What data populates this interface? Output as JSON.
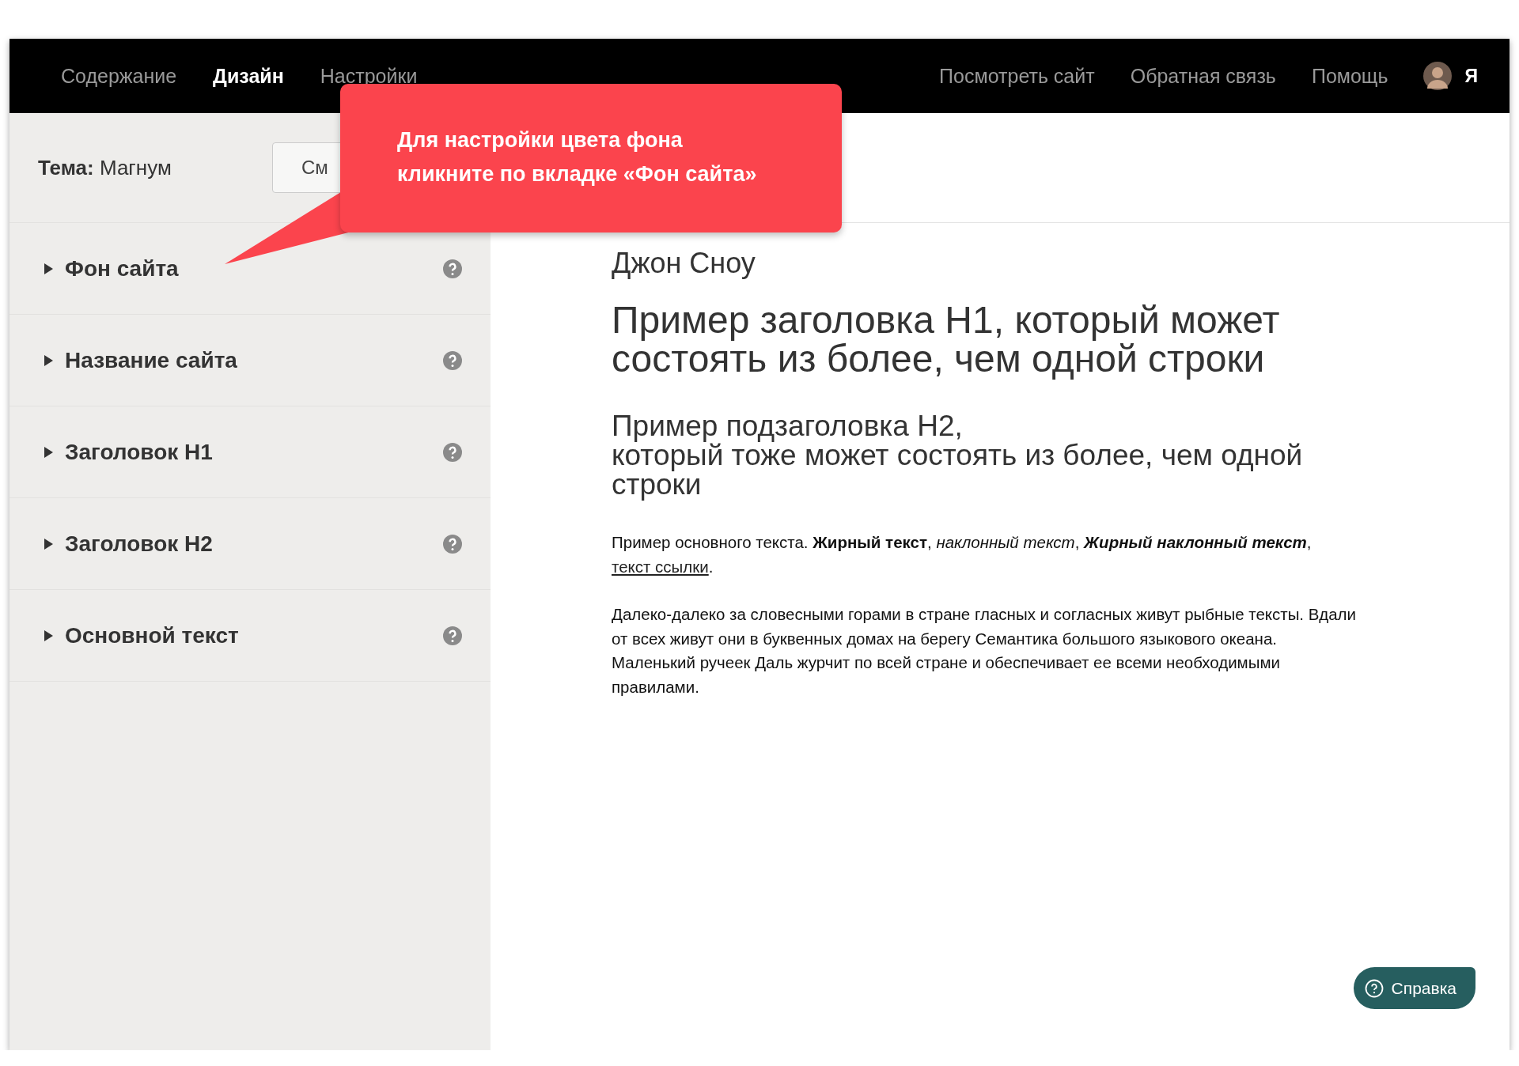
{
  "nav": {
    "tabs": [
      {
        "label": "Содержание",
        "selected": false
      },
      {
        "label": "Дизайн",
        "selected": true
      },
      {
        "label": "Настройки",
        "selected": false
      }
    ],
    "links": [
      "Посмотреть сайт",
      "Обратная связь",
      "Помощь"
    ],
    "user": {
      "label": "Я"
    }
  },
  "sidebar": {
    "theme": {
      "label": "Тема:",
      "value": "Магнум"
    },
    "theme_button": "См",
    "sections": [
      {
        "label": "Фон сайта",
        "expanded": false
      },
      {
        "label": "Название сайта",
        "expanded": false
      },
      {
        "label": "Заголовок H1",
        "expanded": false
      },
      {
        "label": "Заголовок H2",
        "expanded": false
      },
      {
        "label": "Основной текст",
        "expanded": false
      }
    ]
  },
  "preview": {
    "site_title": "Джон Сноу",
    "h1": "Пример заголовка H1, который может состоять из более, чем одной строки",
    "h2": [
      "Пример подзаголовка H2,",
      "который тоже может состоять из более, чем одной строки"
    ],
    "paragraphs": [
      [
        {
          "kind": "plain",
          "text": "Пример основного текста. "
        },
        {
          "kind": "bold",
          "text": "Жирный текст"
        },
        {
          "kind": "plain",
          "text": ", "
        },
        {
          "kind": "italic",
          "text": "наклонный текст"
        },
        {
          "kind": "plain",
          "text": ", "
        },
        {
          "kind": "bold-italic",
          "text": "Жирный наклонный текст"
        },
        {
          "kind": "plain",
          "text": ", "
        },
        {
          "kind": "link",
          "text": "текст ссылки"
        },
        {
          "kind": "plain",
          "text": "."
        }
      ],
      [
        {
          "kind": "plain",
          "text": "Далеко-далеко за словесными горами в стране гласных и согласных живут рыбные тексты. Вдали от всех живут они в буквенных домах на берегу Семантика большого языкового океана. Маленький ручеек Даль журчит по всей стране и обеспечивает ее всеми необходимыми правилами."
        }
      ]
    ]
  },
  "tooltip": {
    "text": "Для настройки цвета фона кликните по вкладке «Фон сайта»"
  },
  "help_button": {
    "label": "Справка"
  }
}
